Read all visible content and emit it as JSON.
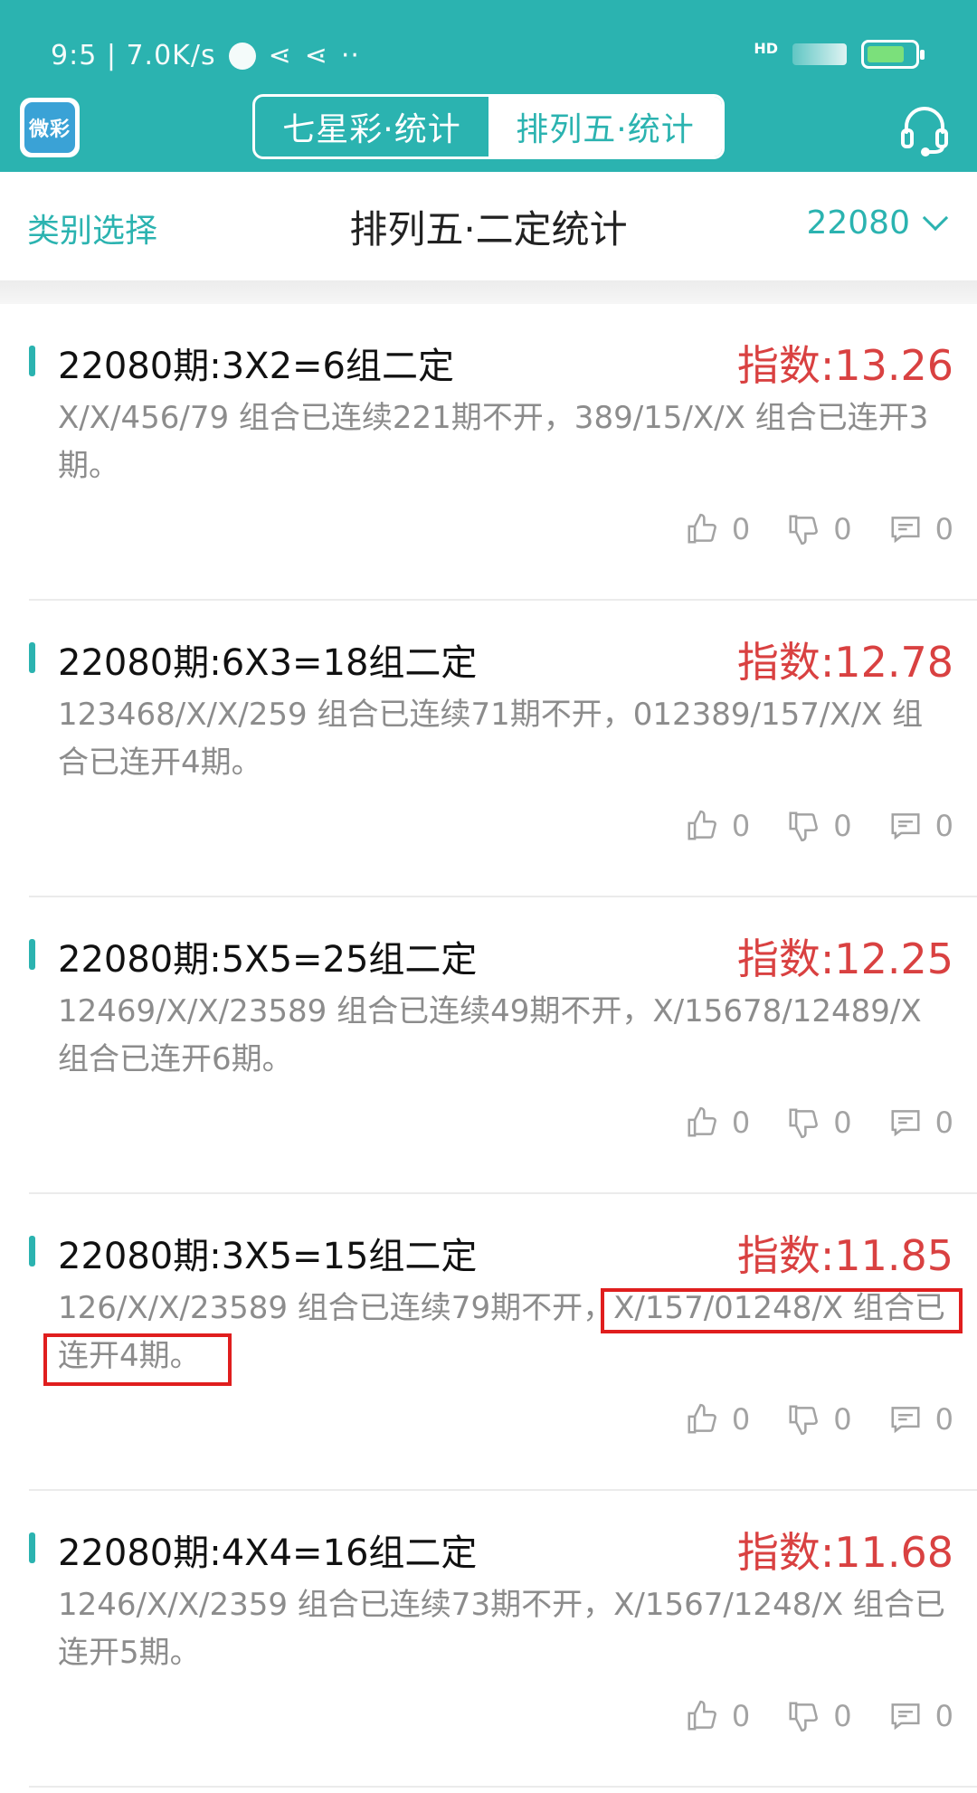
{
  "status": {
    "left_text": "9:5 | 7.0K/s",
    "hd": "HD"
  },
  "app": {
    "logo_text": "微彩"
  },
  "tabs": [
    {
      "label": "七星彩·统计",
      "active": false
    },
    {
      "label": "排列五·统计",
      "active": true
    }
  ],
  "subheader": {
    "category_label": "类别选择",
    "title": "排列五·二定统计",
    "period": "22080"
  },
  "colors": {
    "accent": "#2bb3b0",
    "index_red": "#d94141",
    "highlight": "#e01e1e"
  },
  "items": [
    {
      "title": "22080期:3X2=6组二定",
      "index": "指数:13.26",
      "desc": "X/X/456/79 组合已连续221期不开，389/15/X/X 组合已连开3期。",
      "likes": "0",
      "dislikes": "0",
      "comments": "0"
    },
    {
      "title": "22080期:6X3=18组二定",
      "index": "指数:12.78",
      "desc": "123468/X/X/259 组合已连续71期不开，012389/157/X/X 组合已连开4期。",
      "likes": "0",
      "dislikes": "0",
      "comments": "0"
    },
    {
      "title": "22080期:5X5=25组二定",
      "index": "指数:12.25",
      "desc": "12469/X/X/23589 组合已连续49期不开，X/15678/12489/X 组合已连开6期。",
      "likes": "0",
      "dislikes": "0",
      "comments": "0"
    },
    {
      "title": "22080期:3X5=15组二定",
      "index": "指数:11.85",
      "desc": "126/X/X/23589 组合已连续79期不开，X/157/01248/X 组合已连开4期。",
      "likes": "0",
      "dislikes": "0",
      "comments": "0"
    },
    {
      "title": "22080期:4X4=16组二定",
      "index": "指数:11.68",
      "desc": "1246/X/X/2359 组合已连续73期不开，X/1567/1248/X 组合已连开5期。",
      "likes": "0",
      "dislikes": "0",
      "comments": "0"
    }
  ]
}
